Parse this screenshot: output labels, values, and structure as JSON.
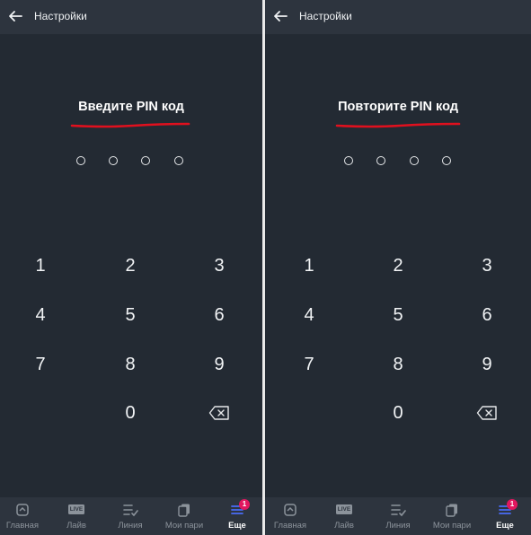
{
  "screens": [
    {
      "header": {
        "title": "Настройки"
      },
      "pin_title": "Введите PIN код"
    },
    {
      "header": {
        "title": "Настройки"
      },
      "pin_title": "Повторите PIN код"
    }
  ],
  "keypad": {
    "keys": [
      "1",
      "2",
      "3",
      "4",
      "5",
      "6",
      "7",
      "8",
      "9",
      "0"
    ]
  },
  "nav": {
    "items": [
      {
        "label": "Главная",
        "icon": "home-icon"
      },
      {
        "label": "Лайв",
        "icon": "live-icon",
        "icon_text": "LIVE"
      },
      {
        "label": "Линия",
        "icon": "line-list-icon"
      },
      {
        "label": "Мои пари",
        "icon": "my-bets-icon"
      },
      {
        "label": "Еще",
        "icon": "more-icon",
        "badge": "1"
      }
    ]
  },
  "colors": {
    "background": "#232a33",
    "bar": "#2d343e",
    "accent_underline": "#e0101e",
    "badge": "#e2175f",
    "nav_inactive": "#8c939b",
    "text": "#ffffff"
  }
}
